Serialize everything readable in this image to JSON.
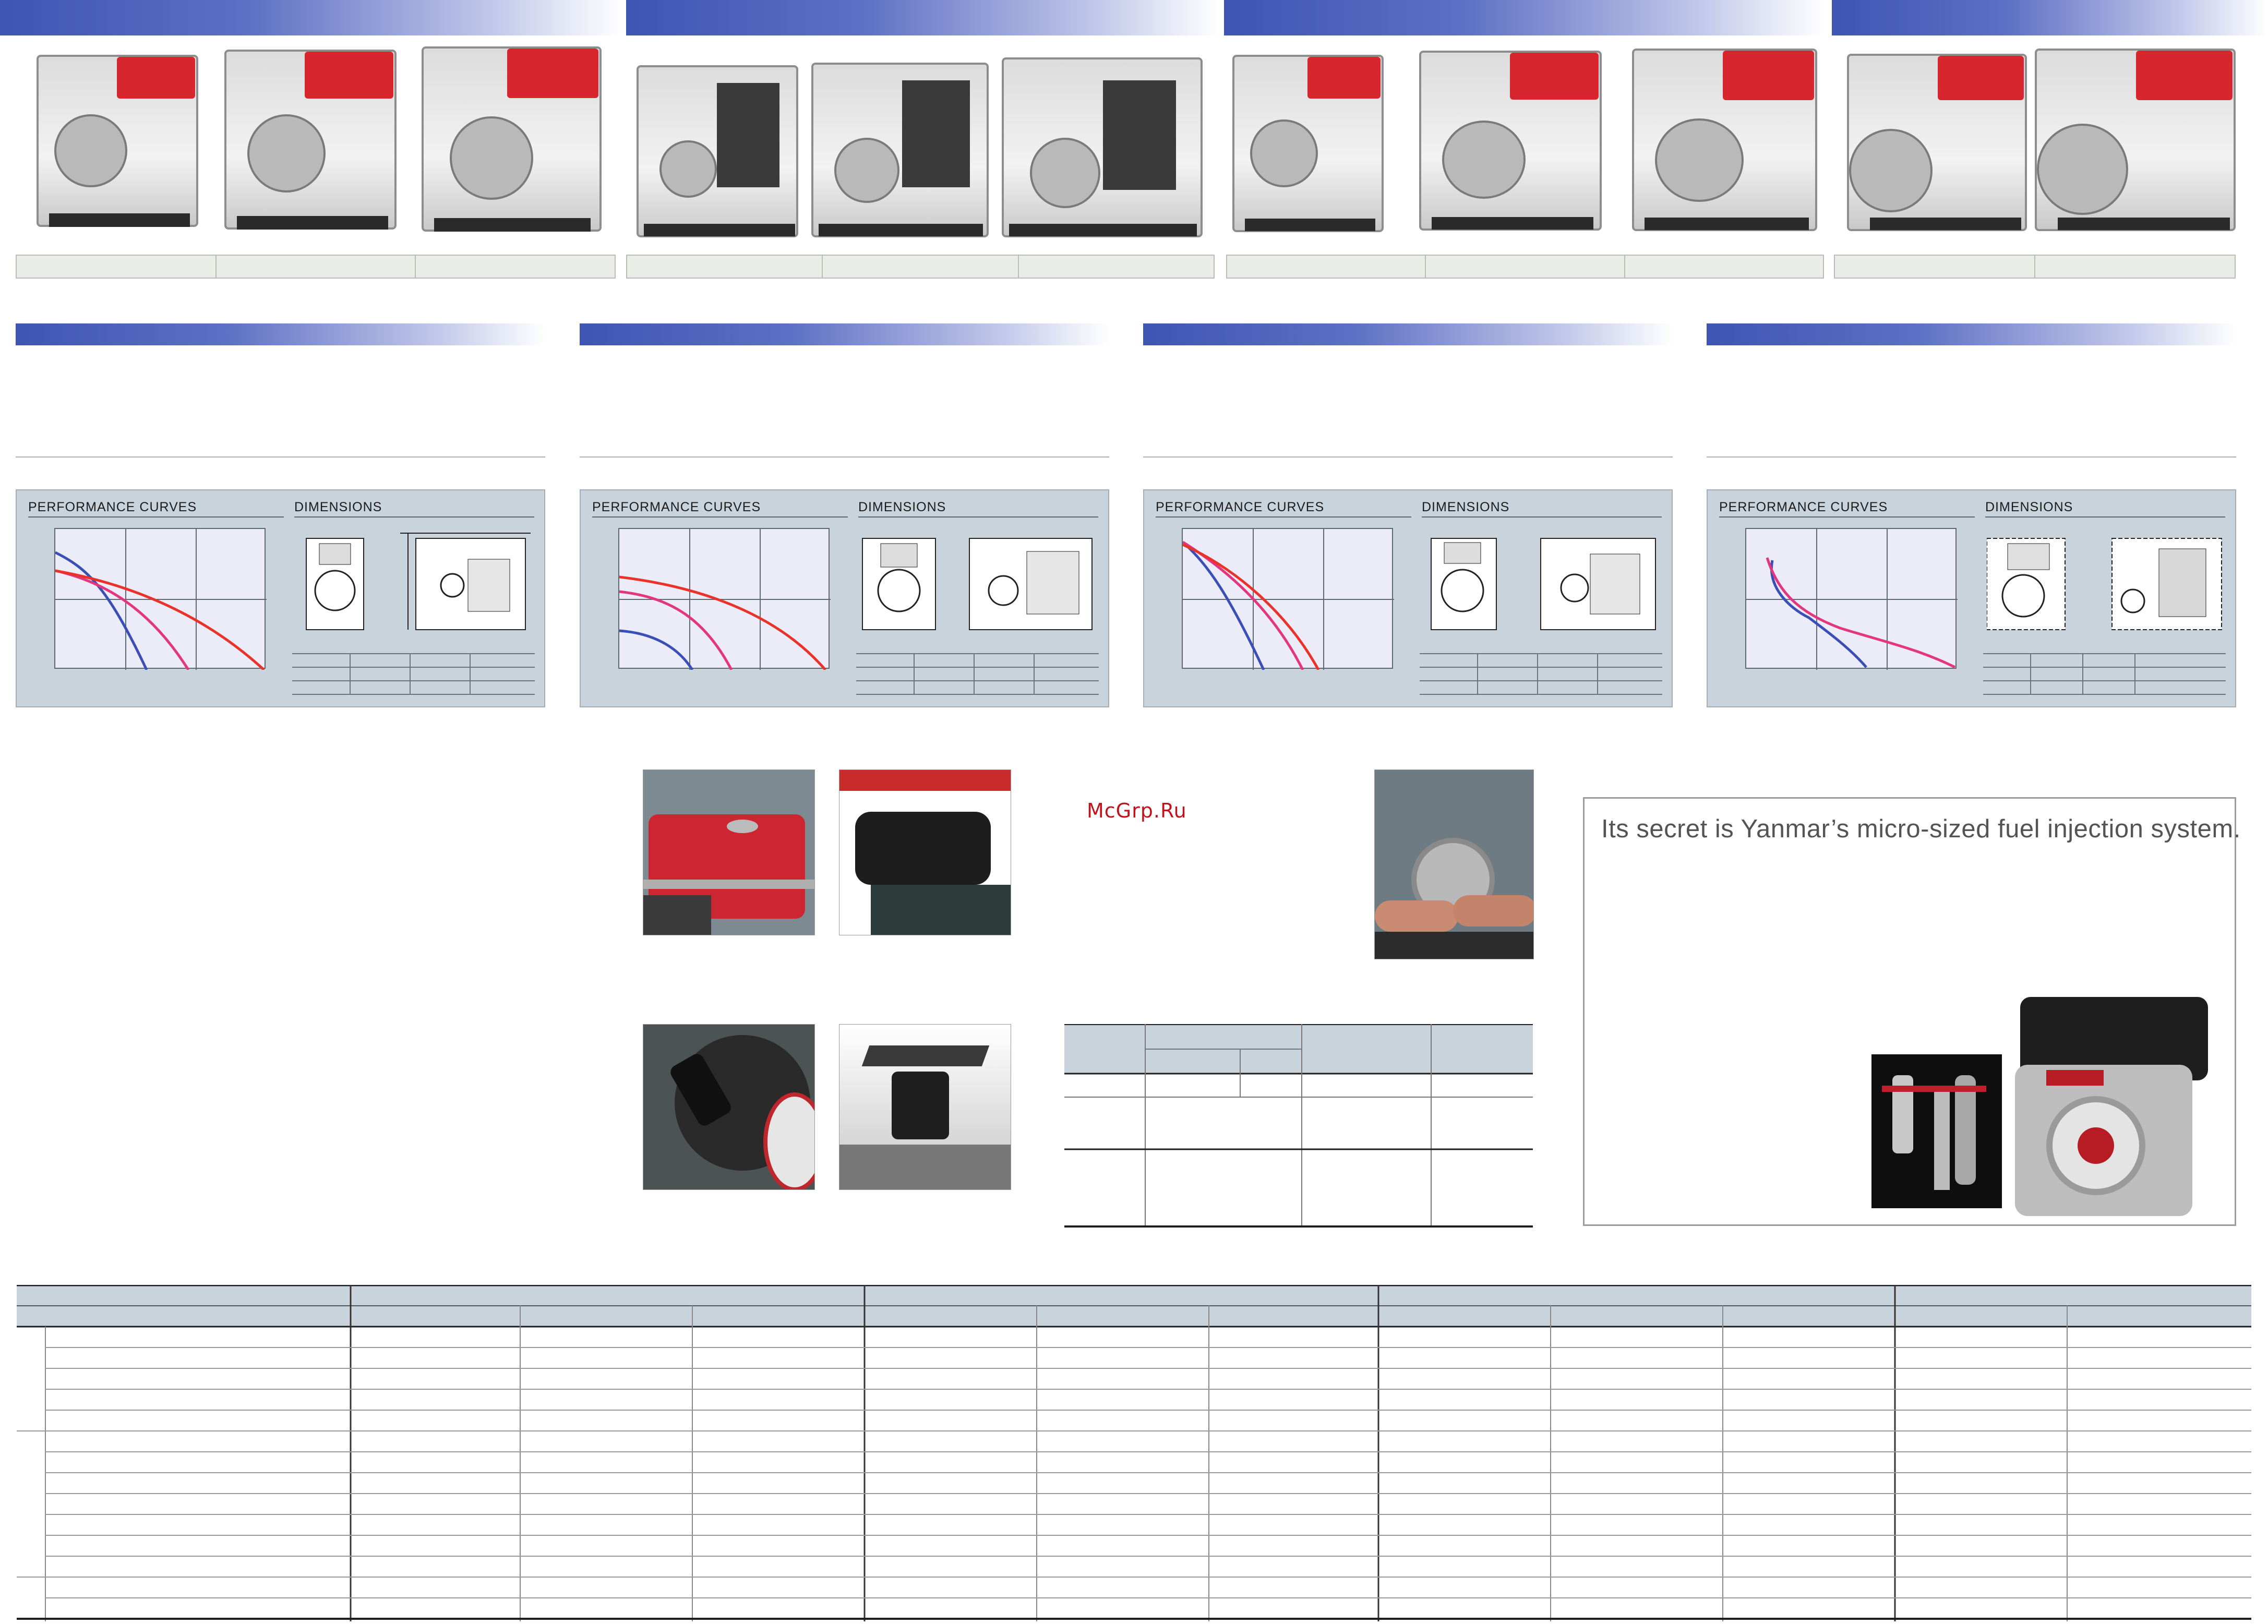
{
  "header_bars": [
    {
      "name": "model-group-1"
    },
    {
      "name": "model-group-2"
    },
    {
      "name": "model-group-3"
    },
    {
      "name": "model-group-4"
    }
  ],
  "sections": [
    {
      "perf_label": "PERFORMANCE CURVES",
      "dim_label": "DIMENSIONS"
    },
    {
      "perf_label": "PERFORMANCE CURVES",
      "dim_label": "DIMENSIONS"
    },
    {
      "perf_label": "PERFORMANCE CURVES",
      "dim_label": "DIMENSIONS"
    },
    {
      "perf_label": "PERFORMANCE CURVES",
      "dim_label": "DIMENSIONS"
    }
  ],
  "watermark": "McGrp.Ru",
  "secret_box": {
    "title": "Its secret is Yanmar’s micro-sized fuel injection system."
  },
  "colors": {
    "header_gradient_start": "#3f55b3",
    "curve_blue": "#3a4fb5",
    "curve_pink": "#e2367f",
    "curve_red": "#e8322a",
    "panel_bg": "#c9d3db",
    "graph_bg": "#ececf8"
  },
  "icons": [
    "water-pump-photo",
    "engine-photo",
    "fuel-tank-photo",
    "fuel-injector-photo"
  ]
}
